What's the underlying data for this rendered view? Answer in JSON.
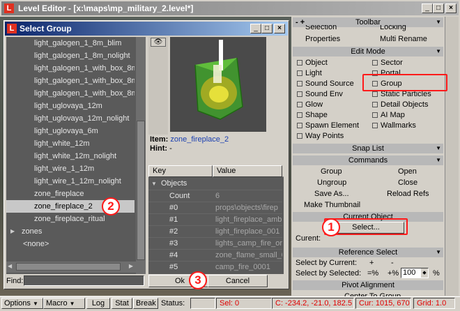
{
  "main_window": {
    "title": "Level Editor - [x:\\maps\\mp_military_2.level*]",
    "logo": "L"
  },
  "dialog": {
    "title": "Select Group",
    "logo": "L",
    "groups": [
      "light_galogen_1_8m_blim",
      "light_galogen_1_8m_nolight",
      "light_galogen_1_with_box_8m",
      "light_galogen_1_with_box_8m",
      "light_galogen_1_with_box_8m",
      "light_uglovaya_12m",
      "light_uglovaya_12m_nolight",
      "light_uglovaya_6m",
      "light_white_12m",
      "light_white_12m_nolight",
      "light_wire_1_12m",
      "light_wire_1_12m_nolight",
      "zone_fireplace",
      "zone_fireplace_2",
      "zone_fireplace_ritual",
      "zones",
      "<none>"
    ],
    "selected_group": "zone_fireplace_2",
    "find_label": "Find:",
    "find_value": "",
    "item_label": "Item:",
    "item_value": "zone_fireplace_2",
    "hint_label": "Hint:",
    "hint_value": "-",
    "table": {
      "col_key": "Key",
      "col_value": "Value",
      "group_label": "Objects",
      "rows": [
        {
          "key": "Count",
          "value": "6"
        },
        {
          "key": "#0",
          "value": "props\\objects\\firep"
        },
        {
          "key": "#1",
          "value": "light_fireplace_amb"
        },
        {
          "key": "#2",
          "value": "light_fireplace_001"
        },
        {
          "key": "#3",
          "value": "lights_camp_fire_or"
        },
        {
          "key": "#4",
          "value": "zone_flame_small_0"
        },
        {
          "key": "#5",
          "value": "camp_fire_0001"
        }
      ]
    },
    "ok_label": "Ok",
    "cancel_label": "Cancel"
  },
  "panel": {
    "toolbar_title": "Toolbar",
    "row_selection": "Selection",
    "row_locking": "Locking",
    "properties": "Properties",
    "multi_rename": "Multi Rename",
    "edit_mode_title": "Edit Mode",
    "edit_mode_left": [
      "Object",
      "Light",
      "Sound Source",
      "Sound Env",
      "Glow",
      "Shape",
      "Spawn Element",
      "Way Points"
    ],
    "edit_mode_right": [
      "Sector",
      "Portal",
      "Group",
      "Static Particles",
      "Detail Objects",
      "AI Map",
      "Wallmarks"
    ],
    "snap_list_title": "Snap List",
    "commands_title": "Commands",
    "commands": {
      "group": "Group",
      "open": "Open",
      "ungroup": "Ungroup",
      "close": "Close",
      "save_as": "Save As...",
      "reload_refs": "Reload Refs",
      "make_thumbnail": "Make Thumbnail"
    },
    "current_object_title": "Current Object",
    "select_button": "Select...",
    "current_label": "Curent:",
    "reference_select_title": "Reference Select",
    "select_by_current": "Select by Current:",
    "plus": "+",
    "minus": "-",
    "select_by_selected": "Select by Selected:",
    "minus_pct": "=%",
    "plus_pct": "+%",
    "percent_value": "100",
    "pct_sign": "%",
    "pivot_alignment_title": "Pivot Alignment",
    "center_to_group": "Center To Group"
  },
  "statusbar": {
    "options": "Options",
    "macro": "Macro",
    "log": "Log",
    "stat": "Stat",
    "break": "Break",
    "status_label": "Status:",
    "sel": "Sel: 0",
    "coords": "C: -234.2, -21.0, 182.5",
    "cur": "Cur: 1015, 670",
    "grid": "Grid: 1.0"
  },
  "annotations": [
    "1",
    "2",
    "3"
  ]
}
